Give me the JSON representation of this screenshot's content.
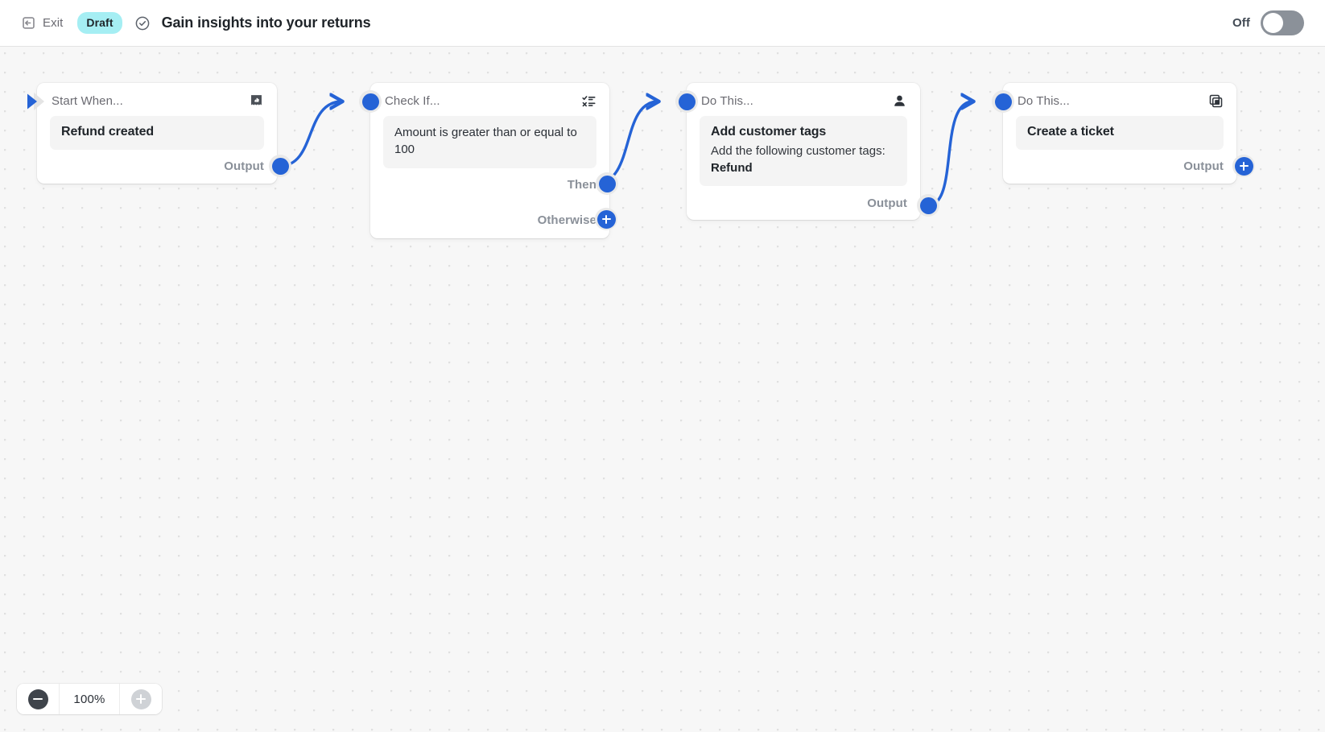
{
  "topbar": {
    "exit_label": "Exit",
    "exit_icon": "exit-icon",
    "status_badge": "Draft",
    "status_check_icon": "check-circle-icon",
    "flow_title": "Gain insights into your returns",
    "toggle_label": "Off",
    "toggle_state": "off",
    "badge_color": "#a5eef3"
  },
  "canvas": {
    "accent_color": "#2563d6",
    "background_color": "#f7f7f7",
    "grid": "dots"
  },
  "nodes": [
    {
      "id": "trigger",
      "head_title": "Start When...",
      "head_icon": "receipt-refund-icon",
      "body_title": "Refund created",
      "ports": [
        {
          "label": "Output",
          "state": "connected"
        }
      ]
    },
    {
      "id": "condition",
      "head_title": "Check If...",
      "head_icon": "checklist-decision-icon",
      "body_title": "Amount is greater than or equal to 100",
      "ports": [
        {
          "label": "Then",
          "state": "connected"
        },
        {
          "label": "Otherwise",
          "state": "empty"
        }
      ]
    },
    {
      "id": "action-tags",
      "head_title": "Do This...",
      "head_icon": "customer-person-icon",
      "body_title": "Add customer tags",
      "body_text": "Add the following customer tags:",
      "body_strong": "Refund",
      "ports": [
        {
          "label": "Output",
          "state": "connected"
        }
      ]
    },
    {
      "id": "action-ticket",
      "head_title": "Do This...",
      "head_icon": "ticket-copy-icon",
      "body_title": "Create a ticket",
      "ports": [
        {
          "label": "Output",
          "state": "empty"
        }
      ]
    }
  ],
  "zoom_control": {
    "zoom_out_icon": "minus-icon",
    "zoom_in_icon": "plus-icon",
    "level": "100%"
  }
}
